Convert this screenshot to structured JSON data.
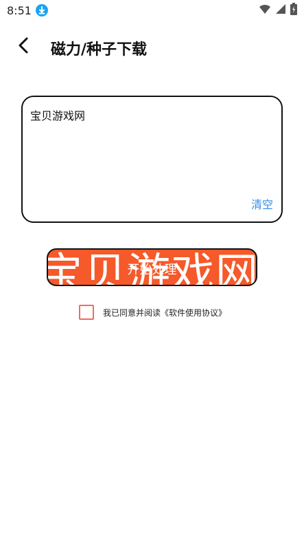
{
  "status_bar": {
    "time": "8:51",
    "icons": [
      "download-icon",
      "wifi-icon",
      "signal-icon",
      "battery-charging-icon"
    ]
  },
  "header": {
    "back_icon": "chevron-left-icon",
    "title": "磁力/种子下载"
  },
  "input": {
    "value": "宝贝游戏网",
    "clear_label": "清空"
  },
  "start_button": {
    "label": "开始处理",
    "watermark": "宝贝游戏网",
    "color": "#f6592a"
  },
  "agreement": {
    "checked": false,
    "text": "我已同意并阅读《软件使用协议》"
  },
  "colors": {
    "accent": "#f6592a",
    "link": "#2f8ee8",
    "checkbox_border": "#f06b5e"
  }
}
